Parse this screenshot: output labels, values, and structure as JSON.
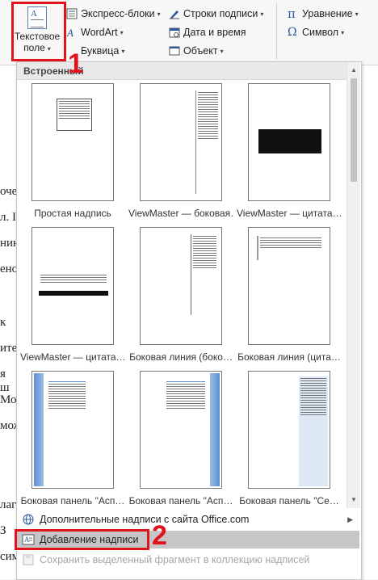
{
  "ribbon": {
    "text_box": {
      "line1": "Текстовое",
      "line2": "поле",
      "caret": "▾"
    },
    "quick_parts": "Экспресс-блоки",
    "wordart": "WordArt",
    "dropcap": "Буквица",
    "signature_line": "Строки подписи",
    "date_time": "Дата и время",
    "object": "Объект",
    "equation": "Уравнение",
    "symbol": "Символ"
  },
  "annotations": {
    "one": "1",
    "two": "2"
  },
  "dropdown": {
    "header": "Встроенный",
    "thumbnails": [
      {
        "caption": "Простая надпись"
      },
      {
        "caption": "ViewMaster — боковая…"
      },
      {
        "caption": "ViewMaster — цитата…"
      },
      {
        "caption": "ViewMaster — цитата…"
      },
      {
        "caption": "Боковая линия (боко…"
      },
      {
        "caption": "Боковая линия (цита…"
      },
      {
        "caption": "Боковая панель \"Асп…"
      },
      {
        "caption": "Боковая панель \"Асп…"
      },
      {
        "caption": "Боковая панель \"Се…"
      }
    ],
    "menu": {
      "more": "Дополнительные надписи с сайта Office.com",
      "add": "Добавление надписи",
      "save": "Сохранить выделенный фрагмент в коллекцию надписей"
    }
  },
  "doc_fragments": [
    "оче",
    "л. I",
    "нин",
    "ено",
    "к",
    "ите",
    "я ш",
    "Мо",
    "мож",
    "лаг",
    "З",
    "сим"
  ],
  "colors": {
    "accent": "#2b579a",
    "annotation_red": "#e1141c",
    "selected_menu": "#c6c6c6"
  }
}
